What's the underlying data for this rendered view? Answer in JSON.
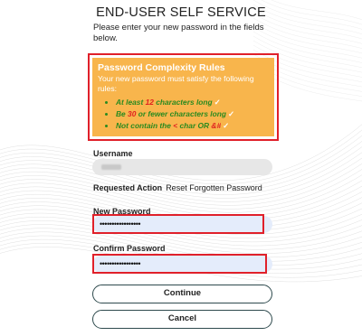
{
  "page": {
    "title": "END-USER SELF SERVICE",
    "instructions": "Please enter your new password in the fields below."
  },
  "rules": {
    "title": "Password Complexity Rules",
    "description": "Your new password must satisfy the following rules:",
    "items": [
      {
        "prefix": "At least ",
        "accent": "12",
        "suffix": " characters long",
        "check": "✓"
      },
      {
        "prefix": "Be ",
        "accent": "30",
        "suffix": " or fewer characters long",
        "check": "✓"
      },
      {
        "prefix": "Not contain the ",
        "accent": "<",
        "middle": " char OR ",
        "accent2": "&#",
        "check": "✓"
      }
    ],
    "colors": {
      "background": "#f8b54c",
      "title": "#ffffff",
      "ok": "#2a8a1f",
      "accent": "#e01f1f"
    }
  },
  "form": {
    "username_label": "Username",
    "username_value": "",
    "requested_action_label": "Requested Action",
    "requested_action_value": "Reset Forgotten Password",
    "new_password_label": "New Password",
    "new_password_mask": "•••••••••••••••••",
    "confirm_password_label": "Confirm Password",
    "confirm_password_mask": "•••••••••••••••••",
    "highlight_color": "#e0202a"
  },
  "buttons": {
    "continue": "Continue",
    "cancel": "Cancel"
  }
}
